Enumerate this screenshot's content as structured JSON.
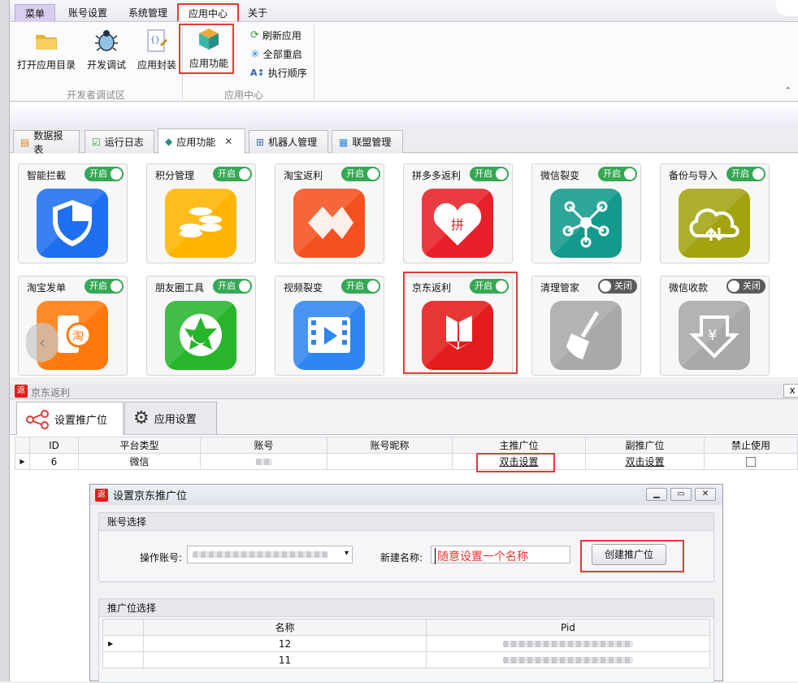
{
  "menubar": {
    "tabs": [
      "菜单",
      "账号设置",
      "系统管理",
      "应用中心",
      "关于"
    ]
  },
  "ribbon": {
    "dev_group": {
      "label": "开发者调试区",
      "buttons": [
        "打开应用目录",
        "开发调试",
        "应用封装"
      ]
    },
    "app_group": {
      "label": "应用中心",
      "big_button": "应用功能",
      "small_buttons": [
        "刷新应用",
        "全部重启",
        "执行顺序"
      ]
    }
  },
  "doc_tabs": [
    "数据报表",
    "运行日志",
    "应用功能",
    "机器人管理",
    "联盟管理"
  ],
  "apps": [
    {
      "name": "智能拦截",
      "state": "开启",
      "on": true,
      "color": "#1e6ff0"
    },
    {
      "name": "积分管理",
      "state": "开启",
      "on": true,
      "color": "#ffb400"
    },
    {
      "name": "淘宝返利",
      "state": "开启",
      "on": true,
      "color": "#f4511e"
    },
    {
      "name": "拼多多返利",
      "state": "开启",
      "on": true,
      "color": "#e8202a"
    },
    {
      "name": "微信裂变",
      "state": "开启",
      "on": true,
      "color": "#129a8c"
    },
    {
      "name": "备份与导入",
      "state": "开启",
      "on": true,
      "color": "#a1a30f"
    },
    {
      "name": "淘宝发单",
      "state": "开启",
      "on": true,
      "color": "#ff7a0d"
    },
    {
      "name": "朋友圈工具",
      "state": "开启",
      "on": true,
      "color": "#27b52c"
    },
    {
      "name": "视频裂变",
      "state": "开启",
      "on": true,
      "color": "#2e86f0"
    },
    {
      "name": "京东返利",
      "state": "开启",
      "on": true,
      "color": "#e31b1b"
    },
    {
      "name": "清理管家",
      "state": "关闭",
      "on": false,
      "color": "#a9a9a9"
    },
    {
      "name": "微信收款",
      "state": "关闭",
      "on": false,
      "color": "#a9a9a9"
    }
  ],
  "jd_panel": {
    "title": "京东返利",
    "close_label": "x",
    "badge": "返",
    "subtabs": [
      "设置推广位",
      "应用设置"
    ],
    "table": {
      "headers": [
        "ID",
        "平台类型",
        "账号",
        "账号昵称",
        "主推广位",
        "副推广位",
        "禁止使用"
      ],
      "rows": [
        {
          "id": "6",
          "platform": "微信",
          "main": "双击设置",
          "sub": "双击设置"
        }
      ]
    }
  },
  "dialog": {
    "title": "设置京东推广位",
    "badge": "返",
    "account_section": "账号选择",
    "account_label": "操作账号:",
    "new_name_label": "新建名称:",
    "new_name_value": "随意设置一个名称",
    "create_button": "创建推广位",
    "position_section": "推广位选择",
    "pos_headers": [
      "名称",
      "Pid"
    ],
    "pos_rows": [
      "12",
      "11"
    ]
  },
  "colors": {
    "highlight": "#e53935",
    "switch_on": "#34a853",
    "switch_off": "#5a5a5a"
  }
}
